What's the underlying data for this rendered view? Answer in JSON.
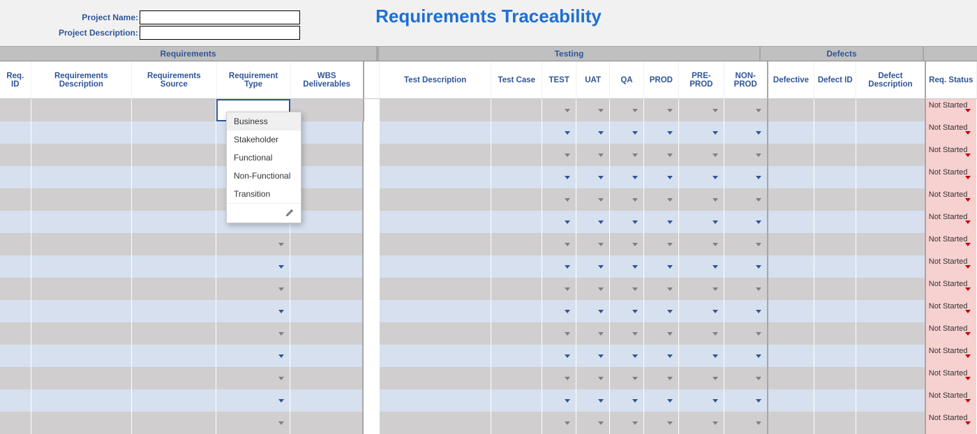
{
  "title": "Requirements Traceability",
  "fields": {
    "project_name_label": "Project Name:",
    "project_name_value": "",
    "project_desc_label": "Project Description:",
    "project_desc_value": ""
  },
  "sections": {
    "requirements": "Requirements",
    "testing": "Testing",
    "defects": "Defects"
  },
  "columns": {
    "req_id": "Req. ID",
    "req_desc": "Requirements Description",
    "req_src": "Requirements Source",
    "req_type": "Requirement Type",
    "wbs": "WBS Deliverables",
    "test_desc": "Test Description",
    "test_case": "Test Case",
    "test": "TEST",
    "uat": "UAT",
    "qa": "QA",
    "prod": "PROD",
    "preprod": "PRE-PROD",
    "nonprod": "NON-PROD",
    "defective": "Defective",
    "defect_id": "Defect ID",
    "defect_desc": "Defect Description",
    "req_status": "Req. Status"
  },
  "status_default": "Not Started",
  "dropdown_options": [
    "Business",
    "Stakeholder",
    "Functional",
    "Non-Functional",
    "Transition"
  ],
  "row_count": 15,
  "colors": {
    "row_gray": "#d0cece",
    "row_blue": "#d6e0ef",
    "status_bg": "#f7d0d0",
    "accent": "#2f5597"
  }
}
